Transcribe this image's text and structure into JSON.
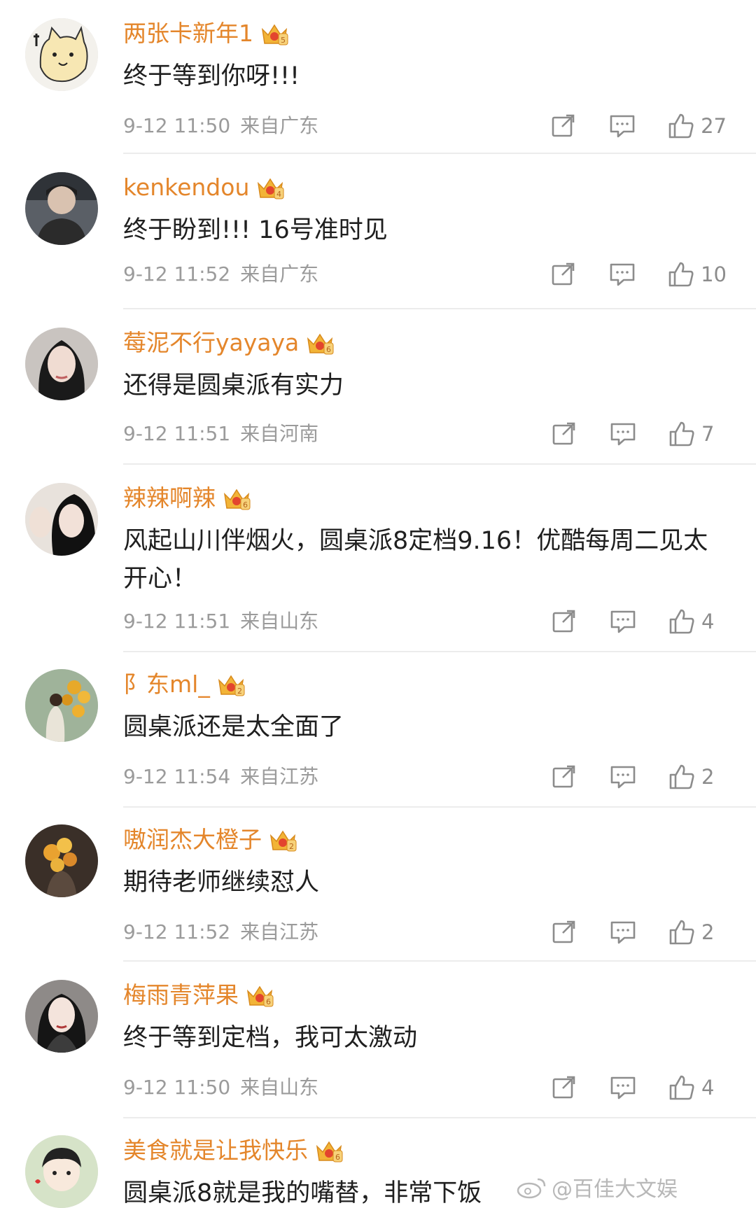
{
  "comments": [
    {
      "name": "两张卡新年1",
      "badge_level": "5",
      "text": "终于等到你呀!!!",
      "time": "9-12 11:50",
      "location": "来自广东",
      "likes": "27",
      "avatar": "cartoon-cat"
    },
    {
      "name": "kenkendou",
      "badge_level": "4",
      "text": "终于盼到!!! 16号准时见",
      "time": "9-12 11:52",
      "location": "来自广东",
      "likes": "10",
      "avatar": "photo-person"
    },
    {
      "name": "莓泥不行yayaya",
      "badge_level": "6",
      "text": "还得是圆桌派有实力",
      "time": "9-12 11:51",
      "location": "来自河南",
      "likes": "7",
      "avatar": "photo-woman"
    },
    {
      "name": "辣辣啊辣",
      "badge_level": "6",
      "text": "风起山川伴烟火，圆桌派8定档9.16！优酷每周二见太开心！",
      "time": "9-12 11:51",
      "location": "来自山东",
      "likes": "4",
      "avatar": "photo-woman-dark"
    },
    {
      "name": "阝东ml_",
      "badge_level": "2",
      "text": "圆桌派还是太全面了",
      "time": "9-12 11:54",
      "location": "来自江苏",
      "likes": "2",
      "avatar": "photo-flowers-green"
    },
    {
      "name": "嗷润杰大橙子",
      "badge_level": "2",
      "text": "期待老师继续怼人",
      "time": "9-12 11:52",
      "location": "来自江苏",
      "likes": "2",
      "avatar": "photo-flowers-dark"
    },
    {
      "name": "梅雨青萍果",
      "badge_level": "6",
      "text": "终于等到定档，我可太激动",
      "time": "9-12 11:50",
      "location": "来自山东",
      "likes": "4",
      "avatar": "photo-woman-glam"
    },
    {
      "name": "美食就是让我快乐",
      "badge_level": "6",
      "text": "圆桌派8就是我的嘴替，非常下饭",
      "time": "",
      "location": "",
      "likes": "",
      "avatar": "cartoon-boy"
    }
  ],
  "watermark": {
    "text": "@百佳大文娱"
  },
  "colors": {
    "username": "#e4862b",
    "meta": "#9b9b9b",
    "divider": "#ececec",
    "icon": "#8c8c8c"
  },
  "icons": {
    "share": "share-icon",
    "reply": "comment-icon",
    "like": "thumbs-up-icon",
    "badge": "crown-badge-icon"
  }
}
